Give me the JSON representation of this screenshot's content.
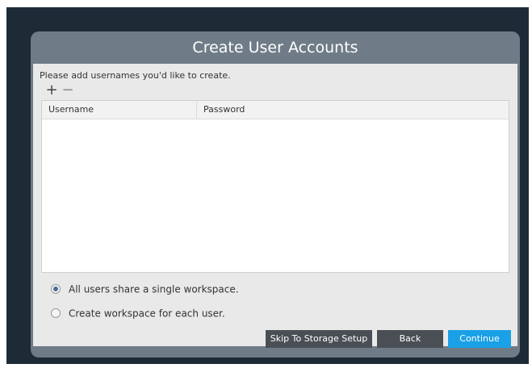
{
  "dialog": {
    "title": "Create User Accounts",
    "instruction": "Please add usernames you'd like to create.",
    "add_icon": "plus-icon",
    "remove_icon": "minus-icon",
    "table": {
      "columns": [
        "Username",
        "Password"
      ],
      "rows": []
    },
    "workspace_options": [
      {
        "label": "All users share a single workspace.",
        "selected": true
      },
      {
        "label": "Create workspace for each user.",
        "selected": false
      }
    ],
    "buttons": {
      "skip": "Skip To Storage Setup",
      "back": "Back",
      "continue": "Continue"
    }
  },
  "colors": {
    "frame": "#1d2b37",
    "dialog": "#6f7c87",
    "content": "#e9e9e9",
    "accent": "#1aa0e6",
    "button_dark": "#4a4f55"
  }
}
